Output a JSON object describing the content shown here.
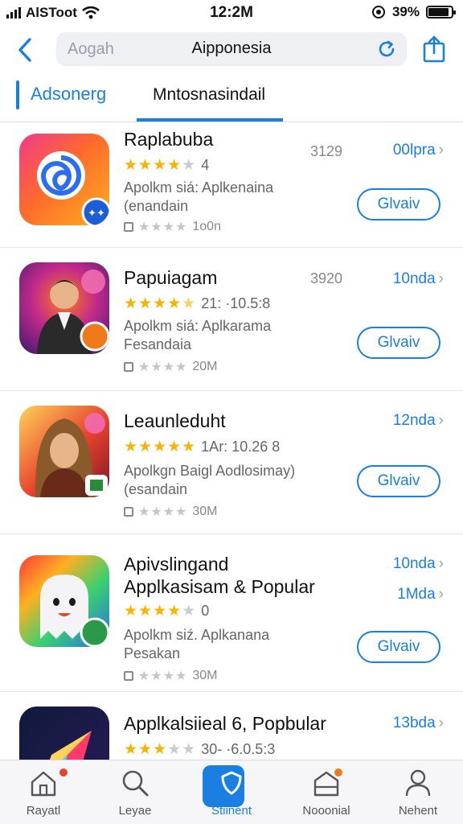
{
  "status_bar": {
    "carrier": "AlSToot",
    "time": "12:2M",
    "battery": "39%"
  },
  "nav": {
    "search_placeholder": "Aogah",
    "title": "Aipponesia"
  },
  "tabs": [
    {
      "label": "Adsonerg"
    },
    {
      "label": "Mntosnasindail"
    }
  ],
  "apps": [
    {
      "name": "Raplabuba",
      "rating": 4,
      "rating_text": "4",
      "description": "Apolkm siá: Aplkenaina\n(enandain",
      "size": "1o0n",
      "count": "3129",
      "price": "00lpra",
      "button": "Glvaiv",
      "icon": "swirl-app-icon"
    },
    {
      "name": "Papuiagam",
      "rating": 4.5,
      "rating_text": "21: ·10.5:8",
      "description": "Apolkm siá: Aplkarama\nFesandaia",
      "size": "20M",
      "count": "3920",
      "price": "10nda",
      "button": "Glvaiv",
      "icon": "portrait-app-icon"
    },
    {
      "name": "Leaunleduht",
      "rating": 5,
      "rating_text": "1Ar: 10.26 8",
      "description": "Apolkgn Baigl Aodlosimay)\n(esandain",
      "size": "30M",
      "count": "",
      "price": "12nda",
      "button": "Glvaiv",
      "icon": "warrior-app-icon"
    },
    {
      "name": "Apivslingand",
      "name2": "Applkasisam & Popular",
      "rating": 4,
      "rating_text": "0",
      "description": "Apolkm siź. Aplkanana\nPesakan",
      "size": "30M",
      "count": "",
      "price": "10nda",
      "price2": "1Mda",
      "button": "Glvaiv",
      "icon": "ghost-app-icon"
    },
    {
      "name": "Applkalsiieal 6, Popbular",
      "rating": 3,
      "rating_text": "30- ·6.0.5:3",
      "description": "",
      "size": "",
      "count": "",
      "price": "13bda",
      "button": "",
      "icon": "arrow-app-icon"
    }
  ],
  "tabbar": [
    {
      "label": "Rayatl",
      "icon": "home-icon"
    },
    {
      "label": "Leyae",
      "icon": "search-icon"
    },
    {
      "label": "Stiinent",
      "icon": "shield-icon"
    },
    {
      "label": "Nooonial",
      "icon": "inbox-icon"
    },
    {
      "label": "Nehent",
      "icon": "person-icon"
    }
  ],
  "colors": {
    "accent": "#1a7fe0",
    "star": "#f5b400"
  }
}
